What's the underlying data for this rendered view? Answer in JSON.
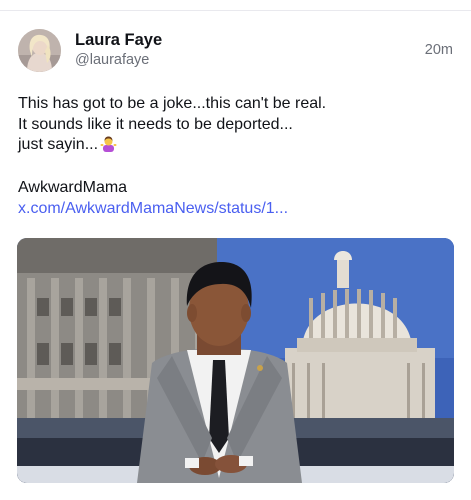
{
  "post": {
    "author_name": "Laura Faye",
    "author_handle": "@laurafaye",
    "timestamp": "20m",
    "text_lines": [
      "This has got to be a joke...this can't be real.",
      "It sounds like it needs to be deported...",
      "just sayin..."
    ],
    "emoji": "person-shrugging-emoji",
    "source_name": "AwkwardMama",
    "source_link": "x.com/AwkwardMamaNews/status/1..."
  },
  "colors": {
    "link": "#4a5ff0",
    "secondary_text": "#6b6f78",
    "divider": "#e9e9ee"
  }
}
